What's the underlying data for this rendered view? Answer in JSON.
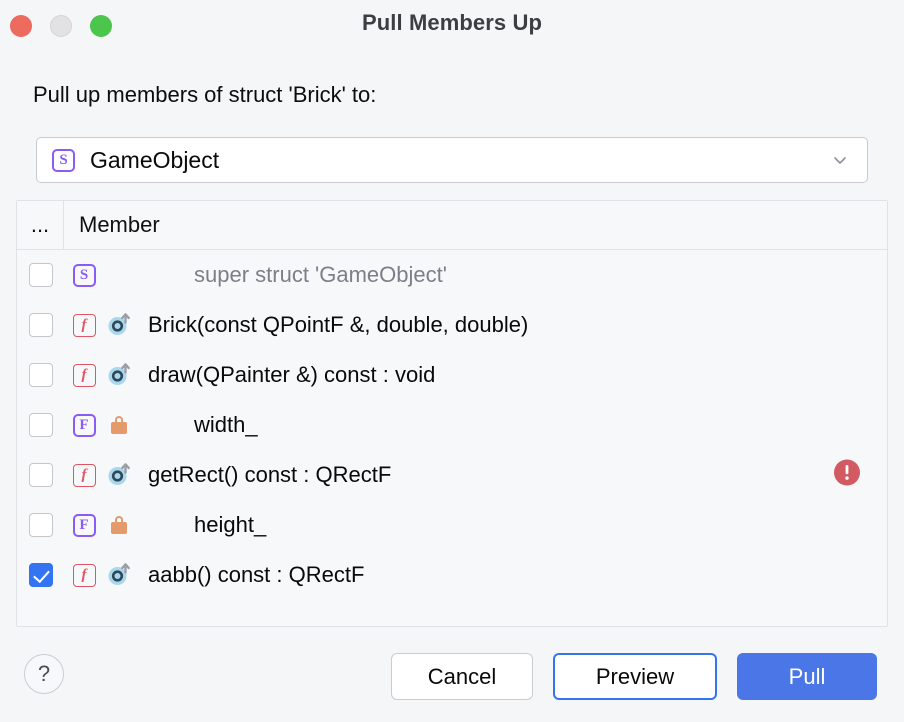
{
  "window": {
    "title": "Pull Members Up",
    "traffic_lights": [
      {
        "name": "close",
        "color": "#ec6a5e"
      },
      {
        "name": "minimize",
        "color": "#e2e2e4"
      },
      {
        "name": "zoom",
        "color": "#4cc54c"
      }
    ]
  },
  "prompt": {
    "label": "Pull up members of struct 'Brick' to:"
  },
  "target_combo": {
    "icon": "struct-icon",
    "icon_glyph": "S",
    "value": "GameObject",
    "arrow_icon": "chevron-down-icon"
  },
  "table": {
    "columns": [
      {
        "key": "checkbox",
        "label": "..."
      },
      {
        "key": "member",
        "label": "Member"
      }
    ],
    "rows": [
      {
        "checked": false,
        "kind_icon": "struct-icon",
        "kind_glyph": "S",
        "visibility_icon": "",
        "label": "super struct 'GameObject'",
        "muted": true,
        "indent": true,
        "warning": false
      },
      {
        "checked": false,
        "kind_icon": "function-icon",
        "kind_glyph": "f",
        "visibility_icon": "public-overrides-icon",
        "label": "Brick(const QPointF &, double, double)",
        "muted": false,
        "indent": false,
        "warning": false
      },
      {
        "checked": false,
        "kind_icon": "function-icon",
        "kind_glyph": "f",
        "visibility_icon": "public-overrides-icon",
        "label": "draw(QPainter &) const : void",
        "muted": false,
        "indent": false,
        "warning": false
      },
      {
        "checked": false,
        "kind_icon": "field-icon",
        "kind_glyph": "F",
        "visibility_icon": "lock-icon",
        "label": "width_",
        "muted": false,
        "indent": true,
        "warning": false
      },
      {
        "checked": false,
        "kind_icon": "function-icon",
        "kind_glyph": "f",
        "visibility_icon": "public-overrides-icon",
        "label": "getRect() const : QRectF",
        "muted": false,
        "indent": false,
        "warning": true
      },
      {
        "checked": false,
        "kind_icon": "field-icon",
        "kind_glyph": "F",
        "visibility_icon": "lock-icon",
        "label": "height_",
        "muted": false,
        "indent": true,
        "warning": false
      },
      {
        "checked": true,
        "kind_icon": "function-icon",
        "kind_glyph": "f",
        "visibility_icon": "public-overrides-icon",
        "label": "aabb() const : QRectF",
        "muted": false,
        "indent": false,
        "warning": false
      }
    ]
  },
  "footer": {
    "help_label": "?",
    "cancel_label": "Cancel",
    "preview_label": "Preview",
    "pull_label": "Pull"
  },
  "colors": {
    "accent_blue": "#3574f0",
    "primary_button": "#4a76e8",
    "struct_purple": "#8a5cf5",
    "function_red": "#e05563",
    "lock_orange": "#e59a6c",
    "warning_red": "#d25a63",
    "muted_text": "#7b7f88"
  }
}
